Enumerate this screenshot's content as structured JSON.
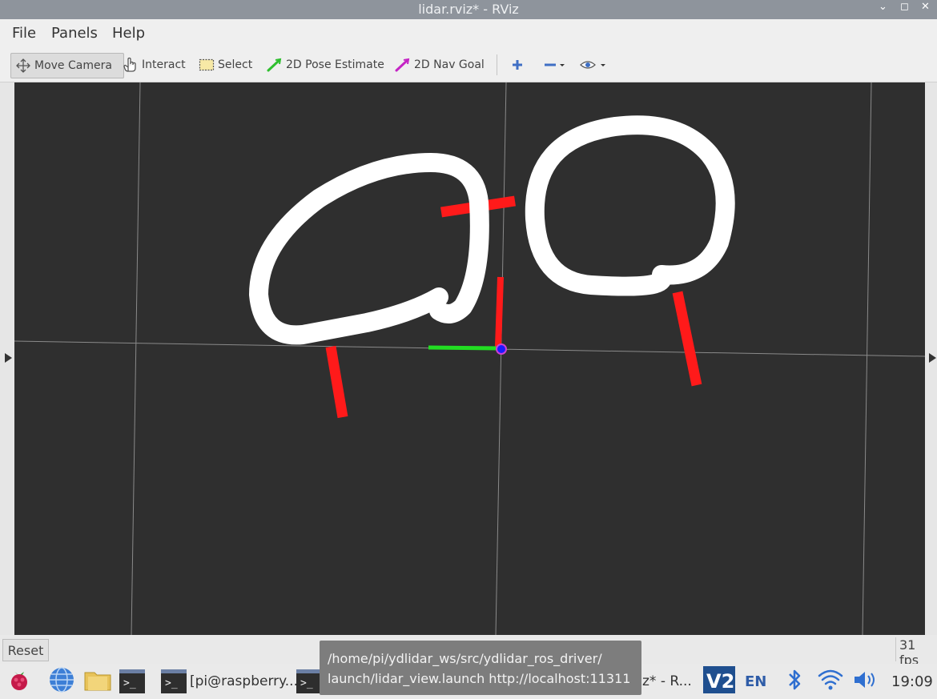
{
  "window": {
    "title": "lidar.rviz* - RViz"
  },
  "menu": {
    "file": "File",
    "panels": "Panels",
    "help": "Help"
  },
  "toolbar": {
    "move_camera": "Move Camera",
    "interact": "Interact",
    "select": "Select",
    "pose_estimate": "2D Pose Estimate",
    "nav_goal": "2D Nav Goal"
  },
  "status": {
    "reset": "Reset",
    "fps": "31 fps"
  },
  "taskbar": {
    "terminal_window": "[pi@raspberry...",
    "rviz_window": "z* - R...",
    "language": "EN",
    "clock": "19:09"
  },
  "tooltip": {
    "line1": "/home/pi/ydlidar_ws/src/ydlidar_ros_driver/",
    "line2": "launch/lidar_view.launch http://localhost:11311"
  },
  "colors": {
    "viewport_bg": "#2f2f2f",
    "grid": "#8a8a8a",
    "scan_points": "#ff1a1a",
    "axis_x": "#ff1a1a",
    "axis_y": "#22dd22",
    "axis_z": "#1a1aff",
    "annotation": "#ffffff"
  }
}
